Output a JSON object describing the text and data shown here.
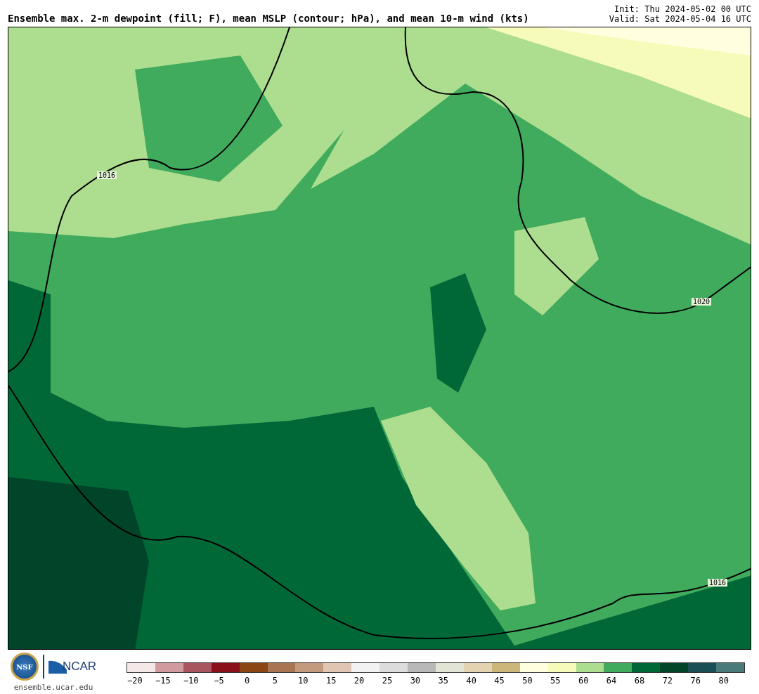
{
  "title": "Ensemble max. 2-m dewpoint (fill; F), mean MSLP (contour; hPa), and mean 10-m wind (kts)",
  "init": "Init: Thu 2024-05-02 00 UTC",
  "valid": "Valid: Sat 2024-05-04 16 UTC",
  "map": {
    "contour_labels": [
      "1016",
      "1020",
      "1016"
    ]
  },
  "logos": {
    "nsf": "NSF",
    "ncar": "NCAR",
    "url": "ensemble.ucar.edu"
  },
  "colorbar": {
    "segments": [
      {
        "color": "#f5e8e8"
      },
      {
        "color": "#d09a9f"
      },
      {
        "color": "#a85560"
      },
      {
        "color": "#8a101c"
      },
      {
        "color": "#8a4512"
      },
      {
        "color": "#a87452"
      },
      {
        "color": "#c39a7d"
      },
      {
        "color": "#e0c6b2"
      },
      {
        "color": "#f2f2f2"
      },
      {
        "color": "#dcdcdc"
      },
      {
        "color": "#b8b8b8"
      },
      {
        "color": "#e2e4d6"
      },
      {
        "color": "#e3d3b0"
      },
      {
        "color": "#cdb67a"
      },
      {
        "color": "#ffffe0"
      },
      {
        "color": "#f7fbb9"
      },
      {
        "color": "#addd8e"
      },
      {
        "color": "#41ab5d"
      },
      {
        "color": "#006837"
      },
      {
        "color": "#004529"
      },
      {
        "color": "#1b4f55"
      },
      {
        "color": "#4a7a7a"
      }
    ],
    "ticks": [
      "−20",
      "−15",
      "−10",
      "−5",
      "0",
      "5",
      "10",
      "15",
      "20",
      "25",
      "30",
      "35",
      "40",
      "45",
      "50",
      "55",
      "60",
      "64",
      "68",
      "72",
      "76",
      "80"
    ]
  }
}
